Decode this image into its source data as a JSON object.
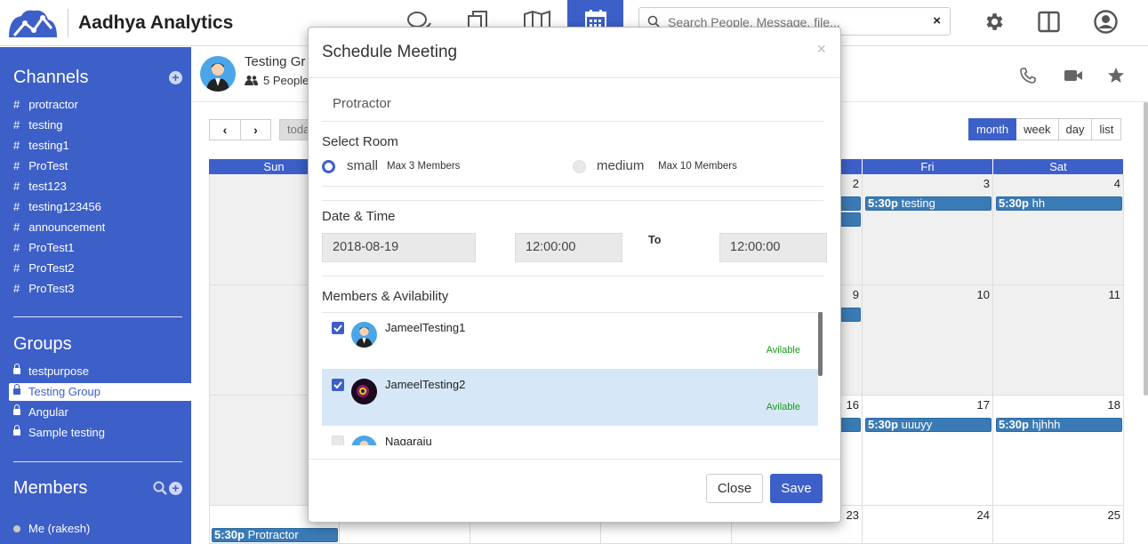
{
  "app": {
    "brand": "Aadhya Analytics"
  },
  "topnav": {
    "icons": [
      "chat-icon",
      "documents-icon",
      "map-icon",
      "calendar-icon"
    ],
    "active": "calendar-icon",
    "search_placeholder": "Search People, Message, file...",
    "search_clear": "×",
    "right_icons": [
      "gear-icon",
      "layout-icon",
      "user-icon"
    ]
  },
  "sidebar": {
    "channels_title": "Channels",
    "channels": [
      "protractor",
      "testing",
      "testing1",
      "ProTest",
      "test123",
      "testing123456",
      "announcement",
      "ProTest1",
      "ProTest2",
      "ProTest3"
    ],
    "groups_title": "Groups",
    "groups": [
      "testpurpose",
      "Testing Group",
      "Angular",
      "Sample testing"
    ],
    "active_group": "Testing Group",
    "members_title": "Members",
    "members": [
      "Me (rakesh)"
    ]
  },
  "channel_header": {
    "name": "Testing Gr",
    "people": "5 People"
  },
  "calendar": {
    "prev": "‹",
    "next": "›",
    "today": "toda",
    "views": [
      "month",
      "week",
      "day",
      "list"
    ],
    "active_view": "month",
    "headers": [
      "Sun",
      "Fri",
      "Sat"
    ],
    "day_numbers": {
      "row1": [
        "2",
        "3",
        "4"
      ],
      "row2": [
        "9",
        "10",
        "11"
      ],
      "row3": [
        "16",
        "17",
        "18"
      ],
      "row4": [
        "23",
        "24",
        "25"
      ]
    },
    "events": [
      {
        "time": "5:30p",
        "title": "testing"
      },
      {
        "time": "5:30p",
        "title": "hh"
      },
      {
        "time": "5:30p",
        "title": "uuuyy"
      },
      {
        "time": "5:30p",
        "title": "hjhhh"
      },
      {
        "time": "5:30p",
        "title": "Protractor"
      }
    ]
  },
  "modal": {
    "title": "Schedule Meeting",
    "close_x": "×",
    "subject": "Protractor",
    "select_room_label": "Select Room",
    "rooms": [
      {
        "name": "small",
        "capacity": "Max 3 Members",
        "selected": true
      },
      {
        "name": "medium",
        "capacity": "Max 10 Members",
        "selected": false
      }
    ],
    "datetime_label": "Date & Time",
    "date": "2018-08-19",
    "start_time": "12:00:00",
    "to_label": "To",
    "end_time": "12:00:00",
    "members_label": "Members & Avilability",
    "members": [
      {
        "name": "JameelTesting1",
        "availability": "Avilable",
        "checked": true
      },
      {
        "name": "JameelTesting2",
        "availability": "Avilable",
        "checked": true
      },
      {
        "name": "Nagaraju",
        "availability": "",
        "checked": false
      }
    ],
    "close_button": "Close",
    "save_button": "Save"
  },
  "colors": {
    "primary": "#3d5fc8",
    "event": "#3b7bb5",
    "available": "#1a9a1a"
  }
}
